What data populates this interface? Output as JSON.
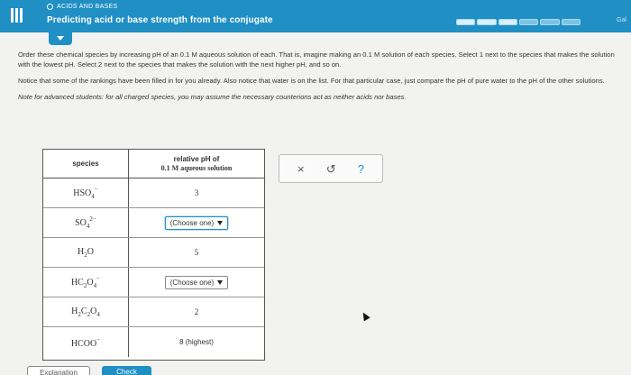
{
  "header": {
    "topic": "ACIDS AND BASES",
    "title": "Predicting acid or base strength from the conjugate",
    "progress_segments": [
      1,
      1,
      1,
      0,
      0,
      0
    ],
    "right_link": "Gal"
  },
  "instructions": {
    "p1": "Order these chemical species by increasing pH of an 0.1 M aqueous solution of each. That is, imagine making an 0.1 M solution of each species. Select 1 next to the species that makes the solution with the lowest pH. Select 2 next to the species that makes the solution with the next higher pH, and so on.",
    "p2": "Notice that some of the rankings have been filled in for you already. Also notice that water is on the list. For that particular case, just compare the pH of pure water to the pH of the other solutions.",
    "note": "Note for advanced students: for all charged species, you may assume the necessary counterions act as neither acids nor bases."
  },
  "table": {
    "header_species": "species",
    "header_ph_line1": "relative pH of",
    "header_ph_line2": "0.1 M aqueous solution",
    "rows": [
      {
        "species": "HSO4-",
        "value": "3"
      },
      {
        "species": "SO4 2-",
        "value": "(Choose one)"
      },
      {
        "species": "H2O",
        "value": "5"
      },
      {
        "species": "HC2O4-",
        "value": "(Choose one)"
      },
      {
        "species": "H2C2O4",
        "value": "2"
      },
      {
        "species": "HCOO-",
        "value": "8 (highest)"
      }
    ]
  },
  "tools": {
    "close": "×",
    "undo": "↺",
    "help": "?"
  },
  "buttons": {
    "explanation": "Explanation",
    "check": "Check"
  }
}
